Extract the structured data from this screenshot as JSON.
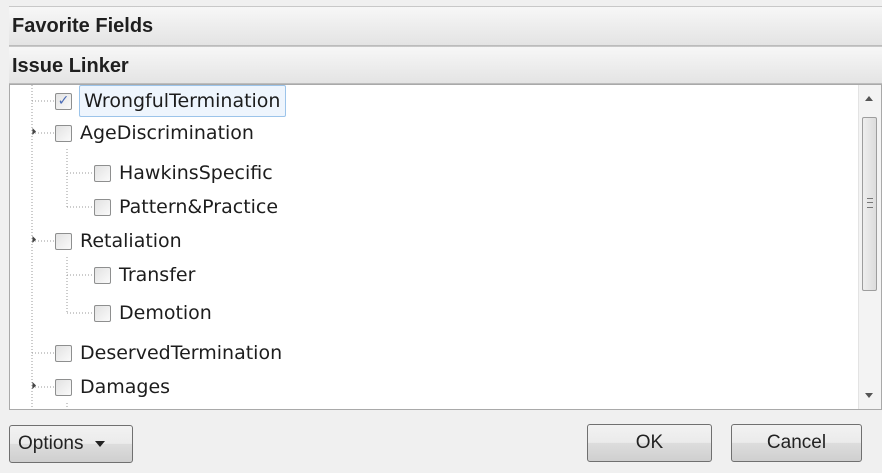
{
  "headers": {
    "favorite_fields": "Favorite Fields",
    "issue_linker": "Issue Linker"
  },
  "tree": {
    "items": [
      {
        "label": "WrongfulTermination",
        "checked": true,
        "level": 0,
        "expanded": null,
        "selected": true
      },
      {
        "label": "AgeDiscrimination",
        "checked": false,
        "level": 0,
        "expanded": true
      },
      {
        "label": "HawkinsSpecific",
        "checked": false,
        "level": 1
      },
      {
        "label": "Pattern&Practice",
        "checked": false,
        "level": 1
      },
      {
        "label": "Retaliation",
        "checked": false,
        "level": 0,
        "expanded": true
      },
      {
        "label": "Transfer",
        "checked": false,
        "level": 1
      },
      {
        "label": "Demotion",
        "checked": false,
        "level": 1
      },
      {
        "label": "DeservedTermination",
        "checked": false,
        "level": 0
      },
      {
        "label": "Damages",
        "checked": false,
        "level": 0,
        "expanded": true
      }
    ]
  },
  "buttons": {
    "options": "Options",
    "ok": "OK",
    "cancel": "Cancel"
  },
  "icons": {
    "checkbox_checked": "checkmark-icon",
    "expander": "expand-triangle-icon",
    "dropdown": "chevron-down-icon"
  }
}
